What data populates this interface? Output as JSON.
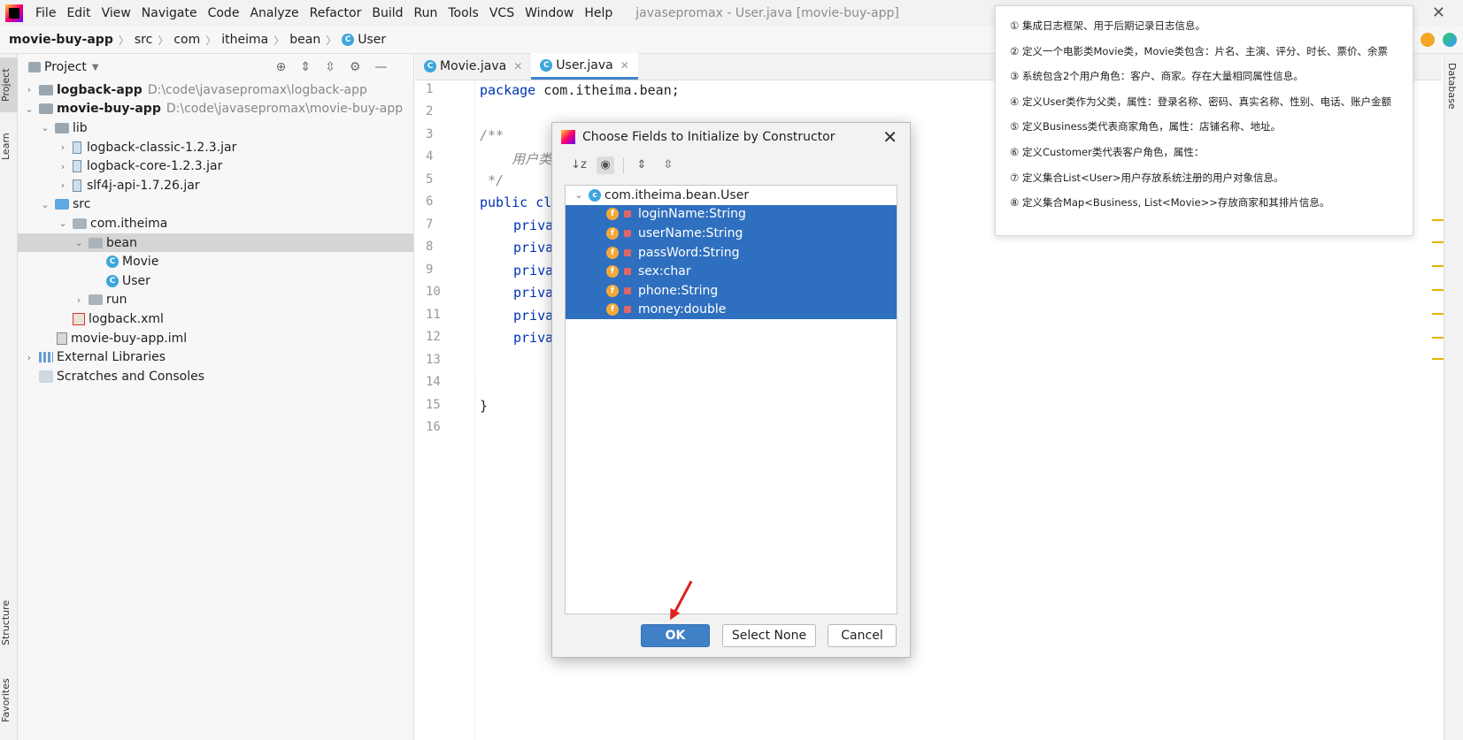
{
  "menubar": {
    "items": [
      "File",
      "Edit",
      "View",
      "Navigate",
      "Code",
      "Analyze",
      "Refactor",
      "Build",
      "Run",
      "Tools",
      "VCS",
      "Window",
      "Help"
    ],
    "window_title": "javasepromax - User.java [movie-buy-app]"
  },
  "breadcrumb": [
    "movie-buy-app",
    "src",
    "com",
    "itheima",
    "bean",
    "User"
  ],
  "left_stripe": {
    "project": "Project",
    "learn": "Learn",
    "structure": "Structure",
    "favorites": "Favorites"
  },
  "right_stripe": {
    "database": "Database"
  },
  "project_panel": {
    "title": "Project",
    "tree": [
      {
        "label": "logback-app",
        "path": "D:\\code\\javasepromax\\logback-app"
      },
      {
        "label": "movie-buy-app",
        "path": "D:\\code\\javasepromax\\movie-buy-app"
      },
      {
        "label": "lib"
      },
      {
        "label": "logback-classic-1.2.3.jar"
      },
      {
        "label": "logback-core-1.2.3.jar"
      },
      {
        "label": "slf4j-api-1.7.26.jar"
      },
      {
        "label": "src"
      },
      {
        "label": "com.itheima"
      },
      {
        "label": "bean"
      },
      {
        "label": "Movie"
      },
      {
        "label": "User"
      },
      {
        "label": "run"
      },
      {
        "label": "logback.xml"
      },
      {
        "label": "movie-buy-app.iml"
      },
      {
        "label": "External Libraries"
      },
      {
        "label": "Scratches and Consoles"
      }
    ]
  },
  "editor": {
    "tabs": [
      "Movie.java",
      "User.java"
    ],
    "line_numbers": [
      "1",
      "2",
      "3",
      "4",
      "5",
      "6",
      "7",
      "8",
      "9",
      "10",
      "11",
      "12",
      "13",
      "14",
      "15",
      "16"
    ],
    "lines": {
      "l1_kw": "package",
      "l1_rest": " com.itheima.bean;",
      "l3": "/**",
      "l4": "    用户类",
      "l5": " */",
      "l6_kw": "public cl",
      "l7": "priva",
      "l8": "priva",
      "l9": "priva",
      "l10": "priva",
      "l11": "priva",
      "l12": "priva",
      "l15": "}"
    }
  },
  "notes": [
    "① 集成日志框架、用于后期记录日志信息。",
    "② 定义一个电影类Movie类，Movie类包含：片名、主演、评分、时长、票价、余票",
    "③ 系统包含2个用户角色：客户、商家。存在大量相同属性信息。",
    "④ 定义User类作为父类，属性：登录名称、密码、真实名称、性别、电话、账户金额",
    "⑤ 定义Business类代表商家角色，属性：店铺名称、地址。",
    "⑥ 定义Customer类代表客户角色，属性：",
    "⑦ 定义集合List<User>用户存放系统注册的用户对象信息。",
    "⑧ 定义集合Map<Business, List<Movie>>存放商家和其排片信息。"
  ],
  "dialog": {
    "title": "Choose Fields to Initialize by Constructor",
    "root": "com.itheima.bean.User",
    "fields": [
      "loginName:String",
      "userName:String",
      "passWord:String",
      "sex:char",
      "phone:String",
      "money:double"
    ],
    "ok": "OK",
    "select_none": "Select None",
    "cancel": "Cancel"
  },
  "colors": {
    "selection": "#2f6fbf",
    "primary_button": "#3f80c7",
    "field_icon": "#f3a93a",
    "class_icon": "#3da6dd"
  }
}
